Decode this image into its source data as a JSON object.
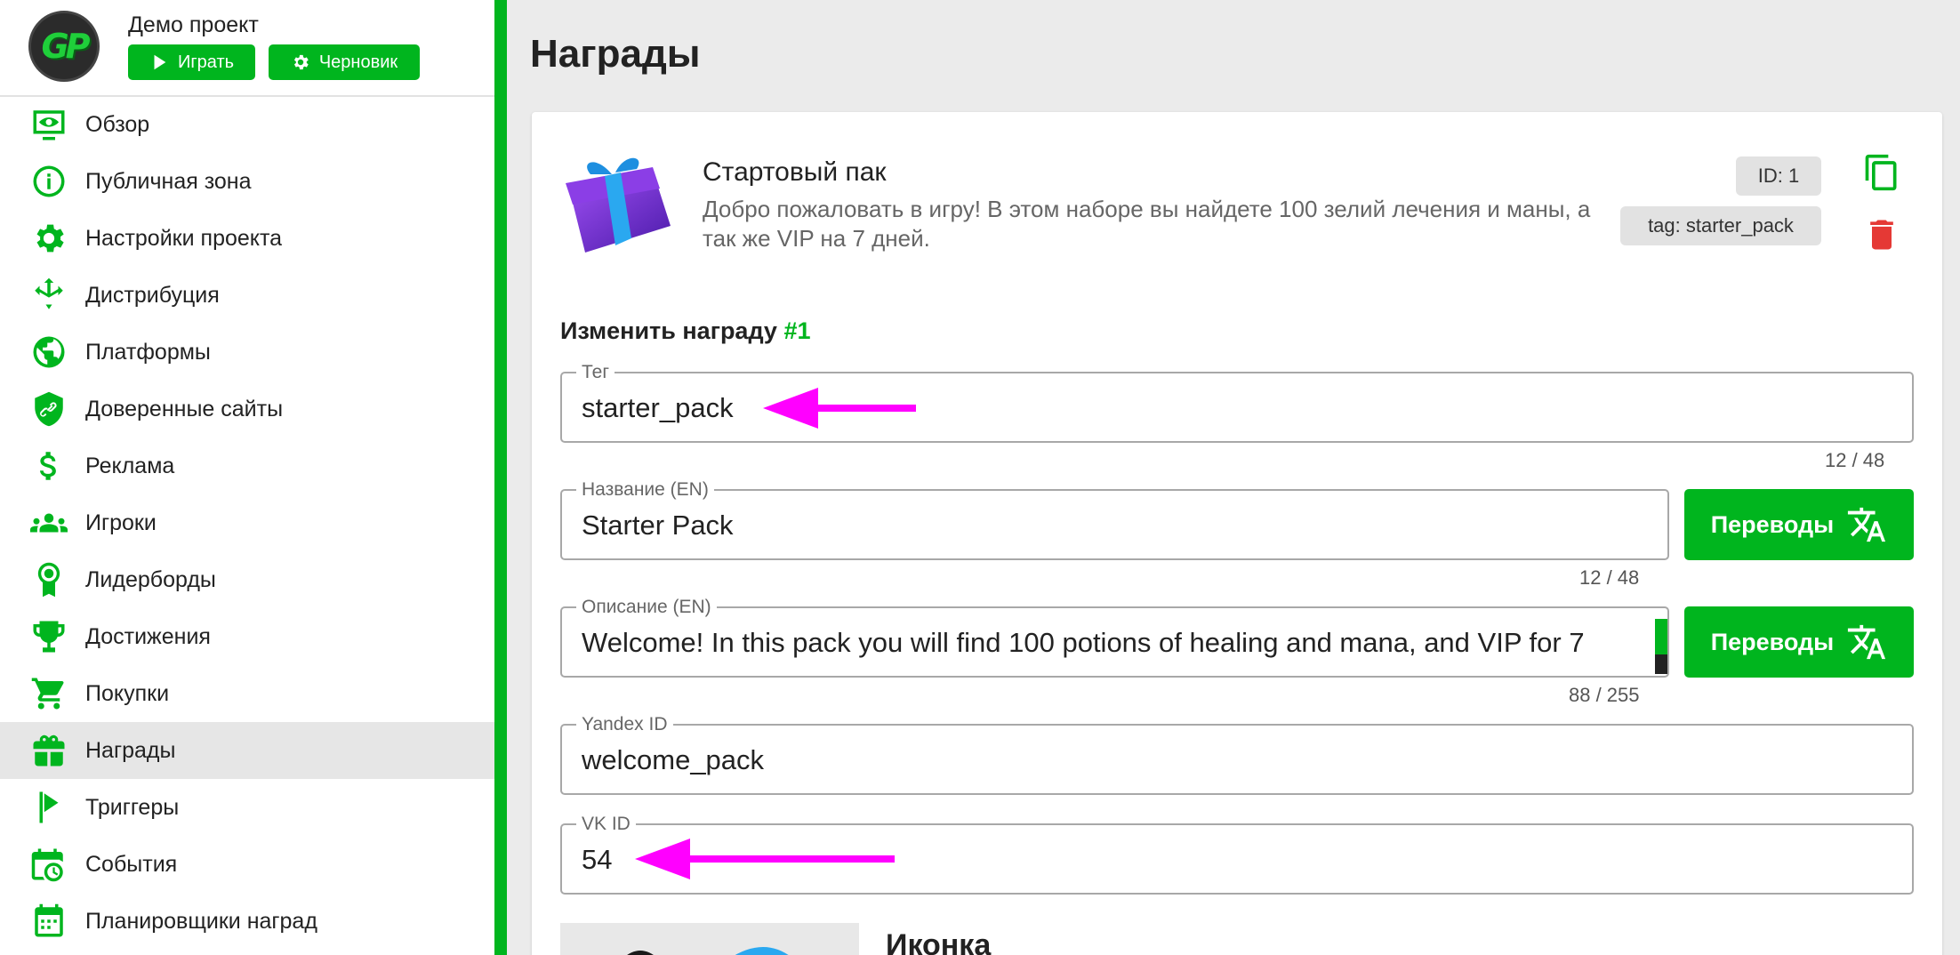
{
  "project": {
    "name": "Демо проект",
    "logo_text": "GP",
    "play_label": "Играть",
    "draft_label": "Черновик"
  },
  "sidebar": {
    "items": [
      {
        "label": "Обзор",
        "icon": "eye-icon"
      },
      {
        "label": "Публичная зона",
        "icon": "info-icon"
      },
      {
        "label": "Настройки проекта",
        "icon": "gear-icon"
      },
      {
        "label": "Дистрибуция",
        "icon": "distribution-icon"
      },
      {
        "label": "Платформы",
        "icon": "globe-icon"
      },
      {
        "label": "Доверенные сайты",
        "icon": "shield-link-icon"
      },
      {
        "label": "Реклама",
        "icon": "dollar-icon"
      },
      {
        "label": "Игроки",
        "icon": "users-icon"
      },
      {
        "label": "Лидерборды",
        "icon": "award-icon"
      },
      {
        "label": "Достижения",
        "icon": "trophy-icon"
      },
      {
        "label": "Покупки",
        "icon": "cart-icon"
      },
      {
        "label": "Награды",
        "icon": "gift-icon",
        "active": true
      },
      {
        "label": "Триггеры",
        "icon": "flag-icon"
      },
      {
        "label": "События",
        "icon": "calendar-clock-icon"
      },
      {
        "label": "Планировщики наград",
        "icon": "calendar-icon"
      }
    ]
  },
  "main": {
    "title": "Награды",
    "reward": {
      "name": "Стартовый пак",
      "description": "Добро пожаловать в игру! В этом наборе вы найдете 100 зелий лечения и маны, а так же VIP на 7 дней.",
      "id_chip": "ID: 1",
      "tag_chip": "tag: starter_pack"
    },
    "edit": {
      "heading": "Изменить награду",
      "number": "#1"
    },
    "fields": {
      "tag": {
        "label": "Тег",
        "value": "starter_pack",
        "counter": "12 / 48"
      },
      "name": {
        "label": "Название (EN)",
        "value": "Starter Pack",
        "counter": "12 / 48"
      },
      "description": {
        "label": "Описание (EN)",
        "value": "Welcome! In this pack you will find 100 potions of healing and mana, and VIP for 7",
        "counter": "88 / 255"
      },
      "yandex": {
        "label": "Yandex ID",
        "value": "welcome_pack"
      },
      "vk": {
        "label": "VK ID",
        "value": "54"
      }
    },
    "translate_label": "Переводы",
    "icon_section_label": "Иконка"
  },
  "colors": {
    "accent": "#00b51e",
    "delete": "#e53935",
    "annotation_arrow": "#ff00ff"
  }
}
